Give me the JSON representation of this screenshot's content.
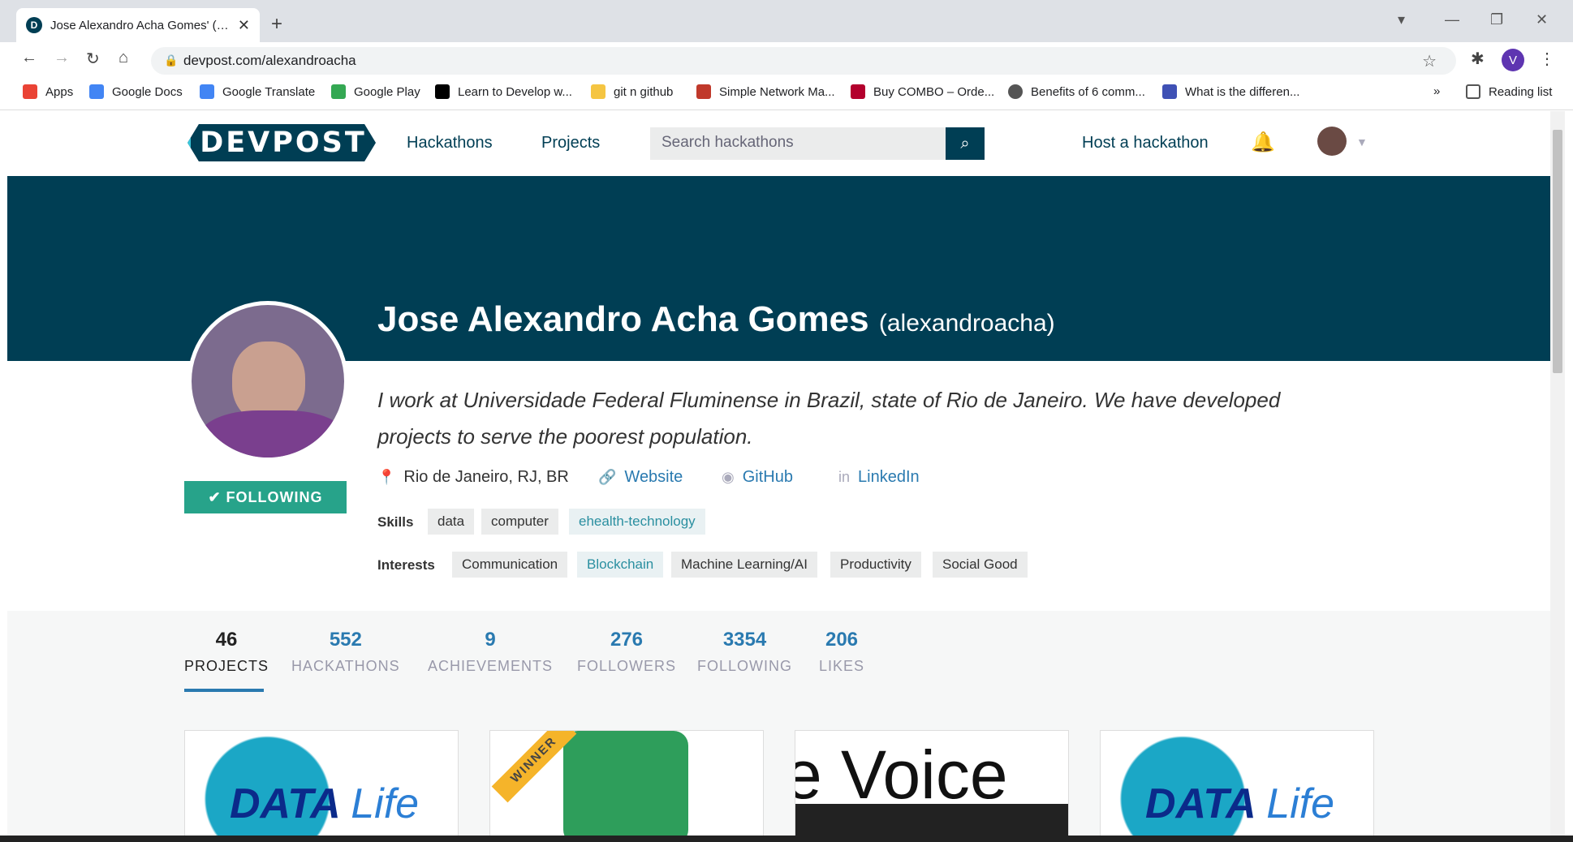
{
  "browser": {
    "tab_title": "Jose Alexandro Acha Gomes' (ale",
    "tab_favicon": "D",
    "url": "devpost.com/alexandroacha",
    "profile_initial": "V",
    "bookmarks": [
      {
        "label": "Apps",
        "icon": "apps-grid-icon",
        "color": "#ea4335"
      },
      {
        "label": "Google Docs",
        "icon": "docs-icon",
        "color": "#4285f4"
      },
      {
        "label": "Google Translate",
        "icon": "translate-icon",
        "color": "#4285f4"
      },
      {
        "label": "Google Play",
        "icon": "play-icon",
        "color": "#34a853"
      },
      {
        "label": "Learn to Develop w...",
        "icon": "m-icon",
        "color": "#000000"
      },
      {
        "label": "git n github",
        "icon": "folder-icon",
        "color": "#f5c542"
      },
      {
        "label": "Simple Network Ma...",
        "icon": "seven-icon",
        "color": "#c0392b"
      },
      {
        "label": "Buy COMBO – Orde...",
        "icon": "dr-icon",
        "color": "#b3002d"
      },
      {
        "label": "Benefits of 6 comm...",
        "icon": "globe-icon",
        "color": "#555555"
      },
      {
        "label": "What is the differen...",
        "icon": "html5-icon",
        "color": "#3f51b5"
      }
    ],
    "more_bookmarks": "»",
    "reading_list": "Reading list"
  },
  "site": {
    "logo": "DEVPOST",
    "nav": [
      "Hackathons",
      "Projects"
    ],
    "search_placeholder": "Search hackathons",
    "host_link": "Host a hackathon"
  },
  "profile": {
    "name": "Jose Alexandro Acha Gomes",
    "username": "(alexandroacha)",
    "bio": "I work at Universidade Federal Fluminense in Brazil, state of Rio de Janeiro. We have developed projects to serve the poorest population.",
    "location": "Rio de Janeiro, RJ, BR",
    "website": "Website",
    "github": "GitHub",
    "linkedin": "LinkedIn",
    "follow_label": "✔ FOLLOWING",
    "skills_label": "Skills",
    "skills": [
      "data",
      "computer",
      "ehealth-technology"
    ],
    "interests_label": "Interests",
    "interests": [
      "Communication",
      "Blockchain",
      "Machine Learning/AI",
      "Productivity",
      "Social Good"
    ]
  },
  "stats": [
    {
      "value": "46",
      "label": "PROJECTS"
    },
    {
      "value": "552",
      "label": "HACKATHONS"
    },
    {
      "value": "9",
      "label": "ACHIEVEMENTS"
    },
    {
      "value": "276",
      "label": "FOLLOWERS"
    },
    {
      "value": "3354",
      "label": "FOLLOWING"
    },
    {
      "value": "206",
      "label": "LIKES"
    }
  ],
  "cards": {
    "data_life": {
      "main": "DATA",
      "script": "Life"
    },
    "winner": "WINNER",
    "voice": "e Voice"
  },
  "colors": {
    "brand": "#003e54",
    "accent": "#27a38a",
    "link": "#2a7ab0"
  }
}
